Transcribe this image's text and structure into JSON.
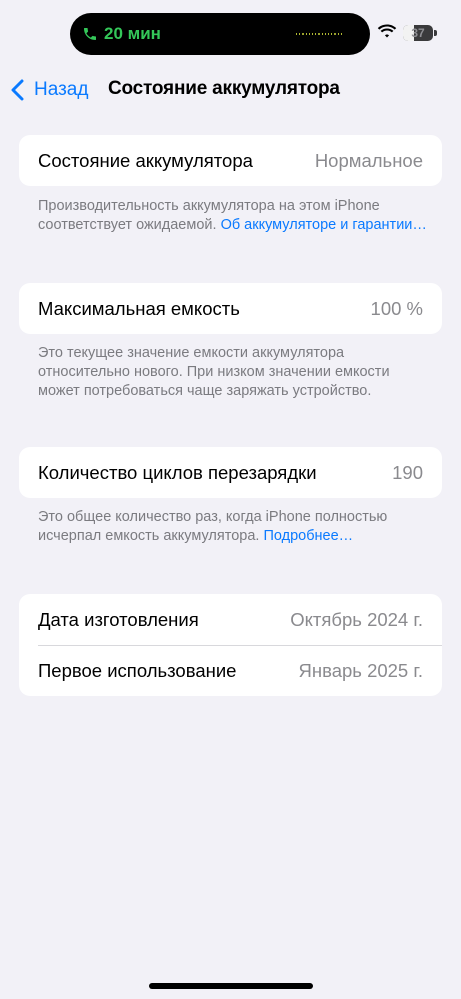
{
  "status_bar": {
    "call_duration": "20 мин",
    "battery_level": "37",
    "battery_fraction": 0.37
  },
  "nav": {
    "back_label": "Назад",
    "title": "Состояние аккумулятора"
  },
  "battery_health": {
    "label": "Состояние аккумулятора",
    "value": "Нормальное",
    "footnote_text": "Производительность аккумулятора на этом iPhone соответствует ожидаемой. ",
    "footnote_link": "Об аккумуляторе и гарантии…"
  },
  "max_capacity": {
    "label": "Максимальная емкость",
    "value": "100 %",
    "footnote_text": "Это текущее значение емкости аккумулятора относительно нового. При низком значении емкости может потребоваться чаще заряжать устройство."
  },
  "cycle_count": {
    "label": "Количество циклов перезарядки",
    "value": "190",
    "footnote_text": "Это общее количество раз, когда iPhone полностью исчерпал емкость аккумулятора. ",
    "footnote_link": "Подробнее…"
  },
  "dates": {
    "manufacture_label": "Дата изготовления",
    "manufacture_value": "Октябрь 2024 г.",
    "first_use_label": "Первое использование",
    "first_use_value": "Январь 2025 г."
  },
  "colors": {
    "accent": "#0a7aff",
    "call_green": "#34c759",
    "background": "#f2f1f7"
  },
  "icons": [
    "phone-icon",
    "wifi-icon",
    "battery-icon",
    "chevron-left-icon"
  ]
}
